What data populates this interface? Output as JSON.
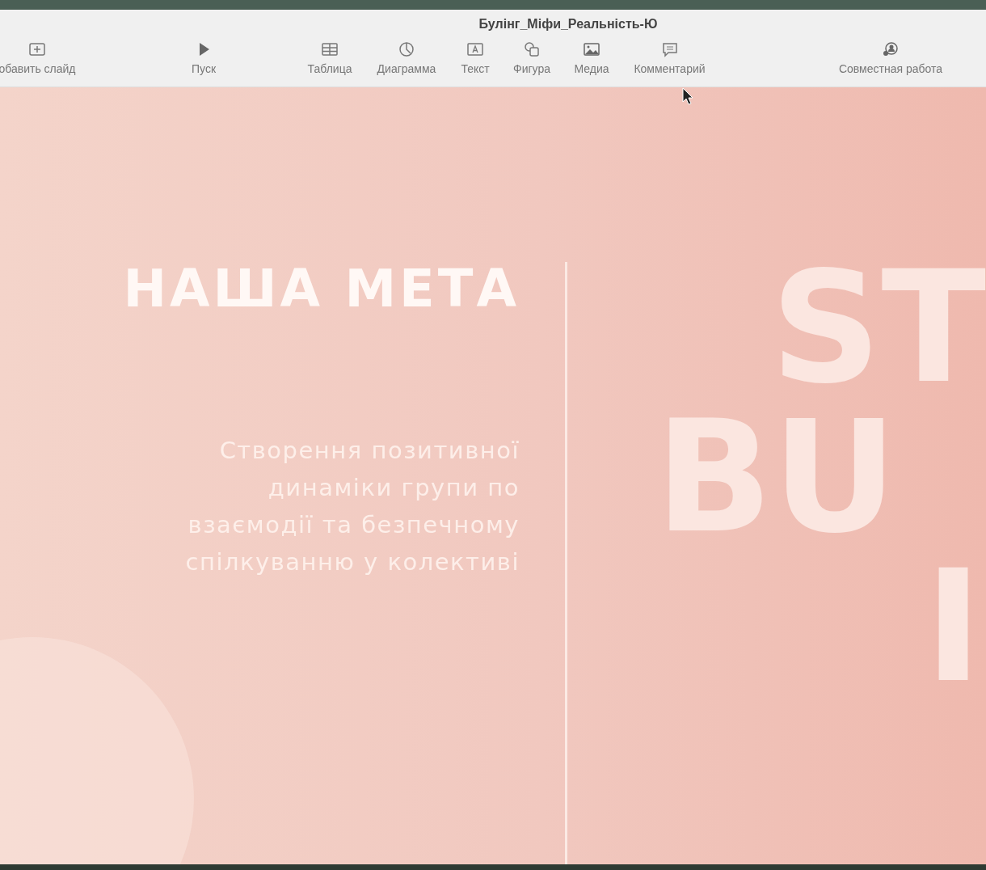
{
  "window": {
    "title": "Булінг_Міфи_Реальність-Ю"
  },
  "toolbar": [
    {
      "kind": "add",
      "label": "обавить слайд"
    },
    {
      "kind": "play",
      "label": "Пуск"
    },
    {
      "kind": "table",
      "label": "Таблица"
    },
    {
      "kind": "chart",
      "label": "Диаграмма"
    },
    {
      "kind": "text",
      "label": "Текст"
    },
    {
      "kind": "shape",
      "label": "Фигура"
    },
    {
      "kind": "media",
      "label": "Медиа"
    },
    {
      "kind": "comment",
      "label": "Комментарий"
    },
    {
      "kind": "collab",
      "label": "Совместная работа"
    }
  ],
  "slide": {
    "heading": "НАША МЕТА",
    "body": [
      "Створення позитивної",
      "динаміки групи по",
      "взаємодії та безпечному",
      "спілкуванню у колективі"
    ],
    "background_words": [
      "ST",
      "BU",
      "I"
    ]
  }
}
